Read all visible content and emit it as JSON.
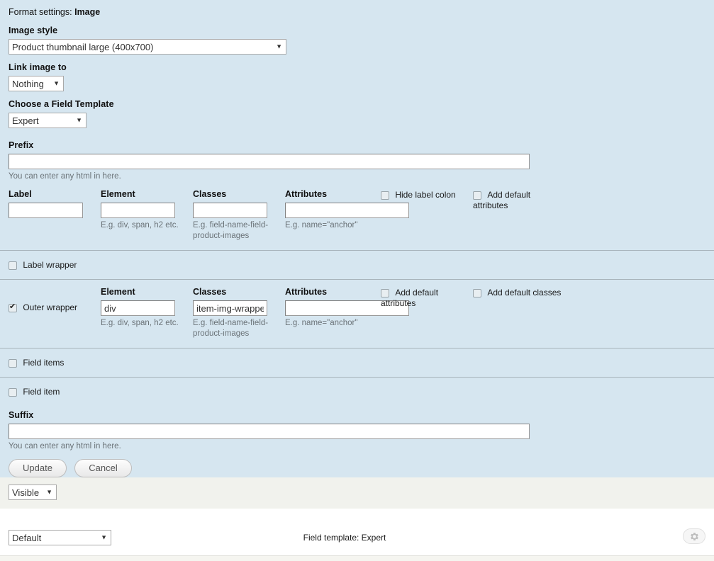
{
  "header": {
    "prefix_text": "Format settings: ",
    "entity_name": "Image"
  },
  "image_style": {
    "label": "Image style",
    "value": "Product thumbnail large (400x700)"
  },
  "link_image_to": {
    "label": "Link image to",
    "value": "Nothing"
  },
  "field_template": {
    "label": "Choose a Field Template",
    "value": "Expert"
  },
  "prefix": {
    "label": "Prefix",
    "value": "",
    "description": "You can enter any html in here."
  },
  "label_row": {
    "label_heading": "Label",
    "element_heading": "Element",
    "classes_heading": "Classes",
    "attributes_heading": "Attributes",
    "label_value": "",
    "element_value": "",
    "classes_value": "",
    "attributes_value": "",
    "element_help": "E.g. div, span, h2 etc.",
    "classes_help": "E.g. field-name-field-product-images",
    "attributes_help": "E.g. name=\"anchor\"",
    "hide_label_colon": "Hide label colon",
    "hide_label_colon_checked": false,
    "add_default_attributes": "Add default attributes",
    "add_default_attributes_checked": false
  },
  "label_wrapper": {
    "label": "Label wrapper",
    "checked": false
  },
  "outer_wrapper": {
    "label": "Outer wrapper",
    "checked": true,
    "element_heading": "Element",
    "classes_heading": "Classes",
    "attributes_heading": "Attributes",
    "element_value": "div",
    "classes_value": "item-img-wrapper",
    "attributes_value": "",
    "element_help": "E.g. div, span, h2 etc.",
    "classes_help": "E.g. field-name-field-product-images",
    "attributes_help": "E.g. name=\"anchor\"",
    "add_default_attributes": "Add default attributes",
    "add_default_attributes_checked": false,
    "add_default_classes": "Add default classes",
    "add_default_classes_checked": false
  },
  "field_items": {
    "label": "Field items",
    "checked": false
  },
  "field_item": {
    "label": "Field item",
    "checked": false
  },
  "suffix": {
    "label": "Suffix",
    "value": "",
    "description": "You can enter any html in here."
  },
  "actions": {
    "update_label": "Update",
    "cancel_label": "Cancel"
  },
  "visibility": {
    "value": "Visible"
  },
  "footer": {
    "format_value": "Default",
    "summary": "Field template: Expert",
    "settings_icon": "gear-icon"
  },
  "colors": {
    "panel_bg": "#d6e6f0",
    "band_bg": "#f1f2ed",
    "divider": "#a8b4bb",
    "help_text": "#6b7378"
  }
}
